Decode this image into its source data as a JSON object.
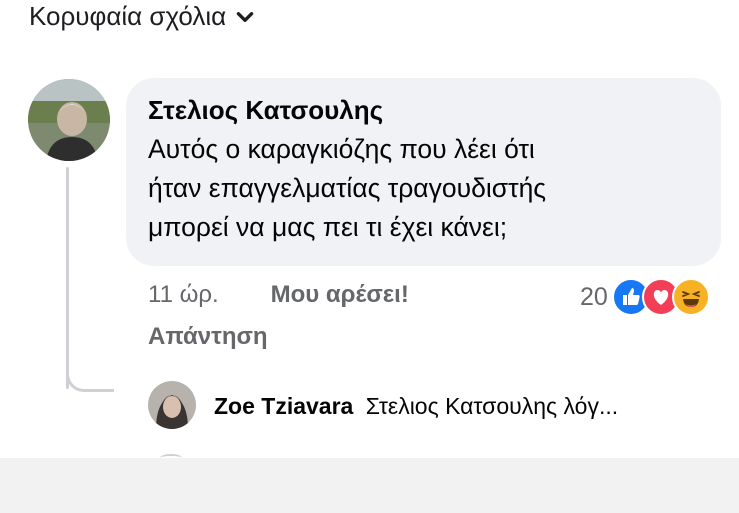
{
  "header": {
    "sort_label": "Κορυφαία σχόλια"
  },
  "comment": {
    "author": "Στελιος Κατσουλης",
    "text": "Αυτός ο καραγκιόζης που λέει ότι\nήταν επαγγελματίας τραγουδιστής\nμπορεί να μας πει τι έχει κάνει;",
    "time": "11 ώρ.",
    "like_label": "Μου αρέσει!",
    "reply_label": "Απάντηση",
    "reaction_count": "20",
    "reaction_icons": [
      "like-icon",
      "love-icon",
      "haha-icon"
    ]
  },
  "reply_preview": {
    "author": "Zoe Tziavara",
    "text": "Στελιος Κατσουλης λόγ..."
  },
  "colors": {
    "like": "#1877f2",
    "love": "#f33e58",
    "haha": "#f7b125",
    "bubble": "#f0f2f5",
    "muted": "#65676b"
  }
}
